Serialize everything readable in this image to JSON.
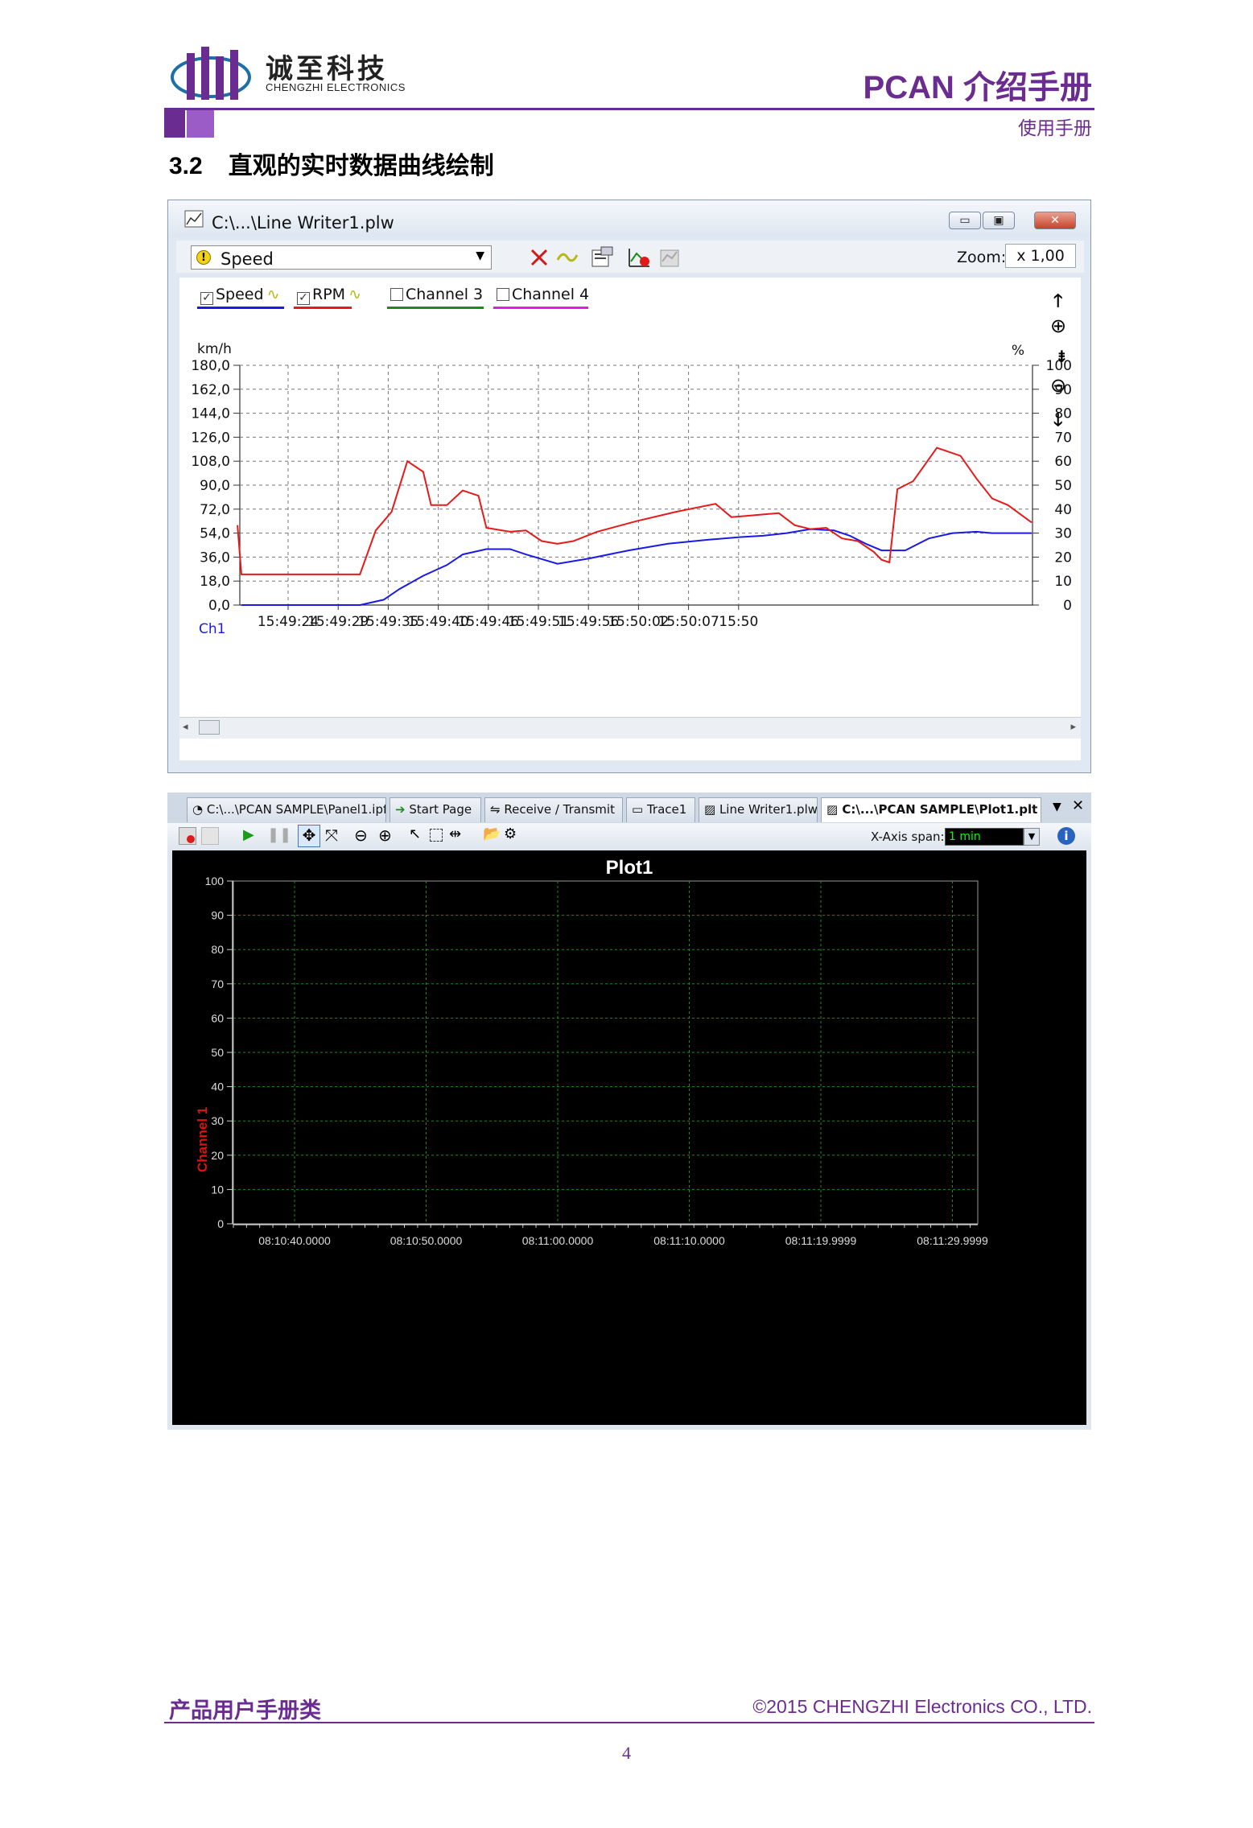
{
  "header": {
    "logo_cn": "诚至科技",
    "logo_en": "CHENGZHI ELECTRONICS",
    "doc_title": "PCAN 介绍手册",
    "doc_subtitle": "使用手册"
  },
  "section": {
    "number": "3.2",
    "title": "直观的实时数据曲线绘制"
  },
  "window1": {
    "title": "C:\\...\\Line Writer1.plw",
    "signal_select": "Speed",
    "zoom_label": "Zoom:",
    "zoom_value": "x 1,00",
    "legend": [
      {
        "label": "Speed",
        "checked": true,
        "color": "#1a1ae6"
      },
      {
        "label": "RPM",
        "checked": true,
        "color": "#e61a1a"
      },
      {
        "label": "Channel 3",
        "checked": false,
        "color": "#1a8c1a"
      },
      {
        "label": "Channel 4",
        "checked": false,
        "color": "#e61ae6"
      }
    ],
    "left_unit": "km/h",
    "right_unit": "%",
    "channel_label": "Ch1"
  },
  "chart_data": {
    "type": "line",
    "title": "",
    "x": [
      "15:49:24",
      "15:49:29",
      "15:49:35",
      "15:49:40",
      "15:49:46",
      "15:49:51",
      "15:49:56",
      "15:50:02",
      "15:50:07",
      "15:50"
    ],
    "left_axis": {
      "label": "km/h",
      "ticks": [
        "180,0",
        "162,0",
        "144,0",
        "126,0",
        "108,0",
        "90,0",
        "72,0",
        "54,0",
        "36,0",
        "18,0",
        "0,0"
      ],
      "ylim": [
        0,
        180
      ]
    },
    "right_axis": {
      "label": "%",
      "ticks": [
        "100",
        "90",
        "80",
        "70",
        "60",
        "50",
        "40",
        "30",
        "20",
        "10",
        "0"
      ],
      "ylim": [
        0,
        100
      ]
    },
    "series": [
      {
        "name": "Speed",
        "color": "#1a1ae6",
        "axis": "left",
        "t": [
          0,
          0.3,
          1.5,
          1.8,
          2.0,
          2.3,
          2.6,
          2.8,
          3.1,
          3.4,
          3.6,
          4.0,
          4.4,
          4.9,
          5.4,
          5.9,
          6.3,
          6.6,
          6.9,
          7.2,
          7.5,
          7.7,
          7.9,
          8.1,
          8.4,
          8.7,
          9.0,
          9.3,
          9.5,
          9.7,
          10.0
        ],
        "y": [
          0,
          0,
          0,
          4,
          12,
          22,
          30,
          38,
          42,
          42,
          38,
          31,
          35,
          41,
          46,
          49,
          51,
          52,
          54,
          57,
          56,
          52,
          46,
          41,
          41,
          50,
          54,
          55,
          54,
          54,
          54
        ]
      },
      {
        "name": "RPM",
        "color": "#e61a1a",
        "axis": "left",
        "t": [
          -0.05,
          0,
          0.3,
          1.5,
          1.7,
          1.9,
          2.1,
          2.3,
          2.4,
          2.6,
          2.8,
          3.0,
          3.1,
          3.2,
          3.4,
          3.6,
          3.8,
          4.0,
          4.2,
          4.5,
          5.0,
          5.5,
          6.0,
          6.2,
          6.4,
          6.6,
          6.8,
          7.0,
          7.2,
          7.4,
          7.6,
          7.8,
          8.0,
          8.1,
          8.2,
          8.3,
          8.5,
          8.8,
          9.1,
          9.3,
          9.5,
          9.7,
          10.0
        ],
        "y": [
          60,
          23,
          23,
          23,
          56,
          70,
          108,
          100,
          75,
          75,
          86,
          82,
          58,
          57,
          55,
          56,
          48,
          46,
          48,
          55,
          63,
          70,
          76,
          66,
          67,
          68,
          69,
          60,
          57,
          58,
          50,
          48,
          40,
          34,
          32,
          87,
          93,
          118,
          112,
          95,
          80,
          75,
          62
        ]
      }
    ]
  },
  "window2": {
    "tabs": [
      "C:\\...\\PCAN SAMPLE\\Panel1.ipf",
      "Start Page",
      "Receive / Transmit",
      "Trace1",
      "Line Writer1.plw",
      "C:\\...\\PCAN SAMPLE\\Plot1.plt"
    ],
    "active_tab": 5,
    "x_axis_span_label": "X-Axis span:",
    "x_axis_span_value": "1 min",
    "plot_title": "Plot1",
    "y_axis_label": "Channel 1"
  },
  "chart_data_plot1": {
    "type": "line",
    "title": "Plot1",
    "ylabel": "Channel 1",
    "yticks": [
      "100",
      "90",
      "80",
      "70",
      "60",
      "50",
      "40",
      "30",
      "20",
      "10",
      "0"
    ],
    "xticks": [
      "08:10:40.0000",
      "08:10:50.0000",
      "08:11:00.0000",
      "08:11:10.0000",
      "08:11:19.9999",
      "08:11:29.9999"
    ],
    "ylim": [
      0,
      100
    ],
    "series": []
  },
  "footer": {
    "left": "产品用户手册类",
    "right": "©2015 CHENGZHI Electronics CO., LTD.",
    "page": "4"
  }
}
